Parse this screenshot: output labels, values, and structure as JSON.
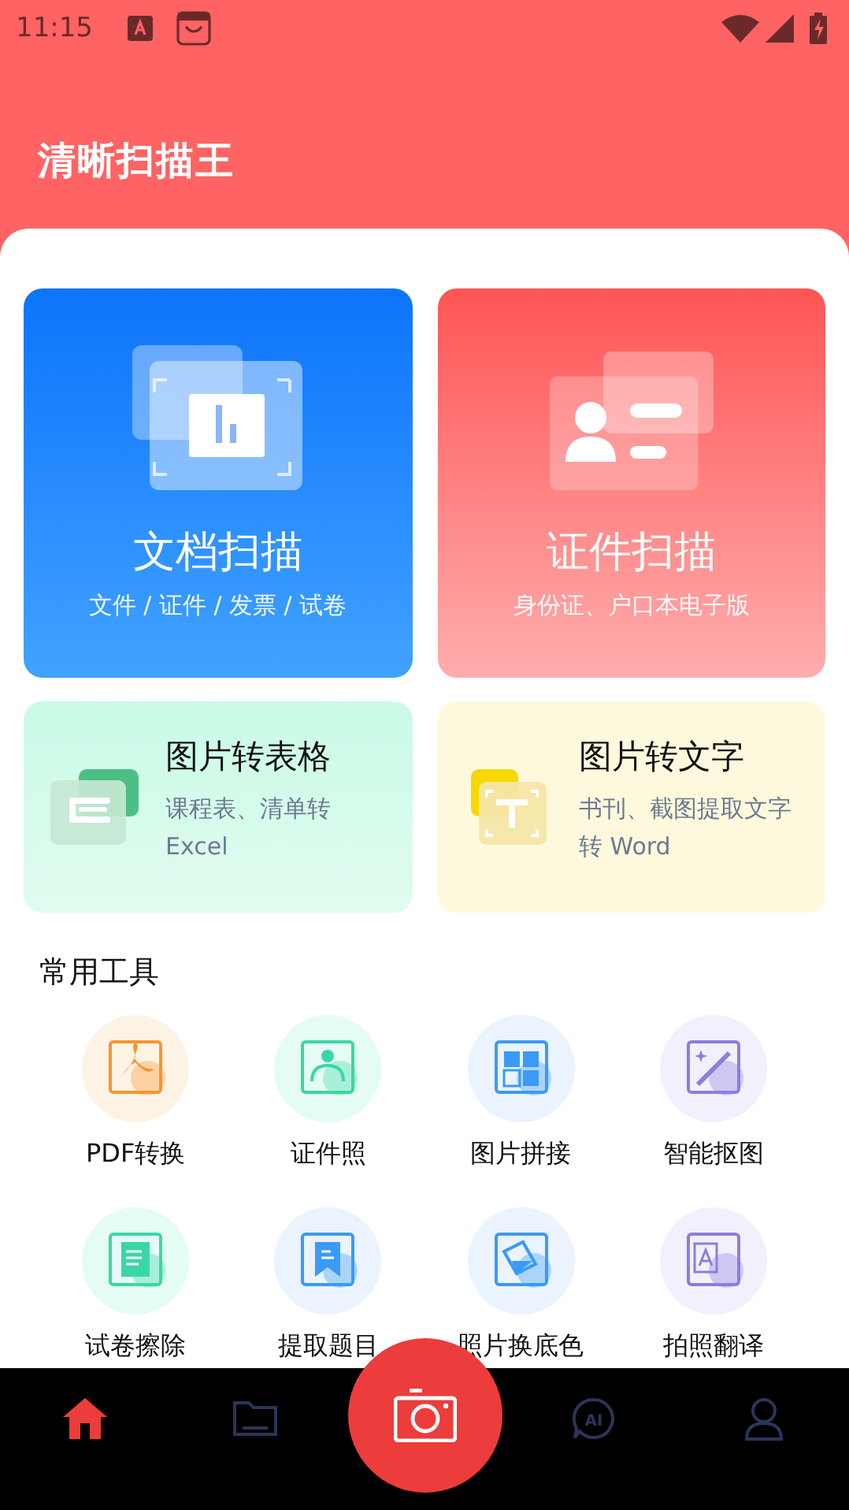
{
  "status_bar": {
    "time": "11:15"
  },
  "header": {
    "title": "清晰扫描王"
  },
  "main_cards": [
    {
      "kind": "document",
      "title": "文档扫描",
      "subtitle": "文件 / 证件 / 发票 / 试卷"
    },
    {
      "kind": "id",
      "title": "证件扫描",
      "subtitle": "身份证、户口本电子版"
    }
  ],
  "feature_cards": [
    {
      "kind": "table",
      "title": "图片转表格",
      "subtitle": "课程表、清单转Excel"
    },
    {
      "kind": "text",
      "title": "图片转文字",
      "subtitle": "书刊、截图提取文字转 Word"
    }
  ],
  "tools_section": {
    "title": "常用工具",
    "tools": [
      {
        "kind": "pdf",
        "label": "PDF转换",
        "color": "#f7952e"
      },
      {
        "kind": "photo",
        "label": "证件照",
        "color": "#3ad6a8"
      },
      {
        "kind": "grid",
        "label": "图片拼接",
        "color": "#3a9af5"
      },
      {
        "kind": "wand",
        "label": "智能抠图",
        "color": "#8a7ee0"
      },
      {
        "kind": "paper",
        "label": "试卷擦除",
        "color": "#3ad6a8"
      },
      {
        "kind": "bookmark",
        "label": "提取题目",
        "color": "#3a9af5"
      },
      {
        "kind": "bucket",
        "label": "照片换底色",
        "color": "#3a9af5"
      },
      {
        "kind": "translate",
        "label": "拍照翻译",
        "color": "#8a7ee0"
      }
    ]
  },
  "bottom_nav": {
    "tabs": [
      {
        "kind": "home",
        "selected": true
      },
      {
        "kind": "folder",
        "selected": false
      },
      {
        "kind": "ai",
        "selected": false,
        "text": "AI"
      },
      {
        "kind": "profile",
        "selected": false
      }
    ]
  }
}
